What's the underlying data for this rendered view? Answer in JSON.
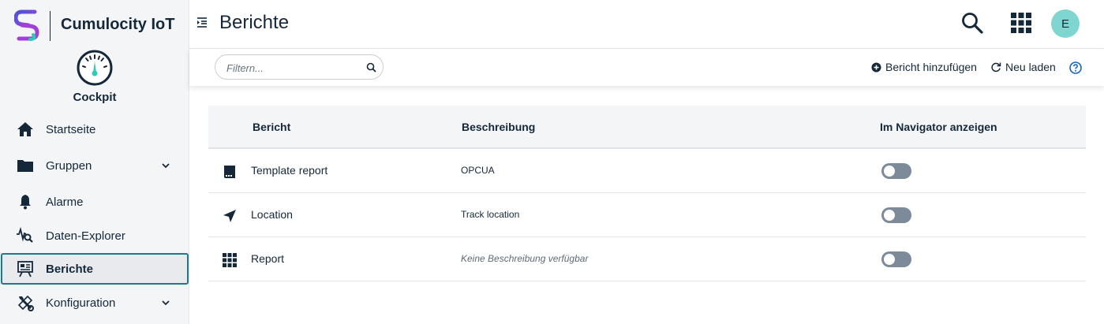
{
  "brand": {
    "name": "Cumulocity IoT"
  },
  "app": {
    "name": "Cockpit"
  },
  "sidebar": {
    "items": [
      {
        "label": "Startseite",
        "icon": "home-icon"
      },
      {
        "label": "Gruppen",
        "icon": "folder-icon",
        "expandable": true
      },
      {
        "label": "Alarme",
        "icon": "bell-icon"
      },
      {
        "label": "Daten-Explorer",
        "icon": "data-explorer-icon"
      },
      {
        "label": "Berichte",
        "icon": "report-board-icon",
        "active": true
      },
      {
        "label": "Konfiguration",
        "icon": "wrench-icon",
        "expandable": true
      }
    ]
  },
  "header": {
    "title": "Berichte",
    "avatar_initial": "E"
  },
  "actionbar": {
    "filter_placeholder": "Filtern...",
    "add_label": "Bericht hinzufügen",
    "reload_label": "Neu laden"
  },
  "table": {
    "columns": [
      "Bericht",
      "Beschreibung",
      "Im Navigator anzeigen"
    ],
    "rows": [
      {
        "name": "Template report",
        "description": "OPCUA",
        "icon": "report-icon",
        "show_in_navigator": false
      },
      {
        "name": "Location",
        "description": "Track location",
        "icon": "location-arrow-icon",
        "show_in_navigator": false
      },
      {
        "name": "Report",
        "description": "Keine Beschreibung verfügbar",
        "icon": "grid-icon",
        "show_in_navigator": false
      }
    ]
  },
  "colors": {
    "text": "#14283a",
    "accent": "#1e7b86",
    "avatar": "#7fd6d1",
    "toggle_off": "#7d8a99",
    "logo_purple": "#6b3fd1",
    "logo_teal": "#2fc9b5"
  }
}
